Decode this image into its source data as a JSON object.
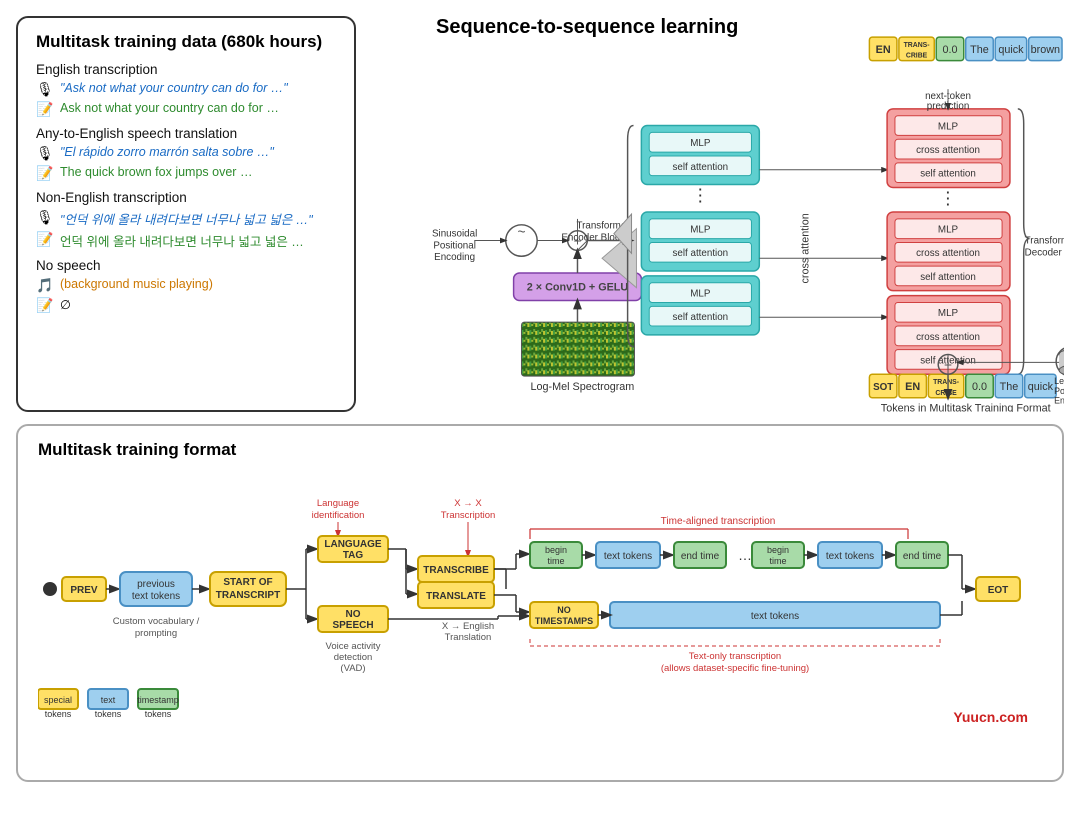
{
  "top": {
    "left_title": "Multitask training data (680k hours)",
    "sections": [
      {
        "label": "English transcription",
        "rows": [
          {
            "icon": "🎙",
            "text": "\"Ask not what your country can do for …\"",
            "type": "blue"
          },
          {
            "icon": "📝",
            "text": "Ask not what your country can do for …",
            "type": "green"
          }
        ]
      },
      {
        "label": "Any-to-English speech translation",
        "rows": [
          {
            "icon": "🎙",
            "text": "\"El rápido zorro marrón salta sobre …\"",
            "type": "blue"
          },
          {
            "icon": "📝",
            "text": "The quick brown fox jumps over …",
            "type": "green"
          }
        ]
      },
      {
        "label": "Non-English transcription",
        "rows": [
          {
            "icon": "🎙",
            "text": "\"언덕 위에 올라 내려다보면 너무나 넓고 넓은 …\"",
            "type": "blue"
          },
          {
            "icon": "📝",
            "text": "언덕 위에 올라 내려다보면 너무나 넓고 넓은 …",
            "type": "green"
          }
        ]
      },
      {
        "label": "No speech",
        "rows": [
          {
            "icon": "🎵",
            "text": "(background music playing)",
            "type": "orange"
          },
          {
            "icon": "📝",
            "text": "∅",
            "type": "plain"
          }
        ]
      }
    ],
    "seq_title": "Sequence-to-sequence learning"
  },
  "bottom": {
    "title": "Multitask training format",
    "nodes": {
      "prev": "PREV",
      "prev_text": "previous\ntext tokens",
      "sot": "START OF\nTRANSCRIPT",
      "lang_tag": "LANGUAGE\nTAG",
      "no_speech": "NO\nSPEECH",
      "transcribe": "TRANSCRIBE",
      "translate": "TRANSLATE",
      "begin_time": "begin\ntime",
      "text_tokens": "text tokens",
      "end_time": "end time",
      "no_timestamps": "NO\nTIMESTAMPS",
      "text_tokens2": "text tokens",
      "eot": "EOT"
    },
    "annotations": {
      "custom_vocab": "Custom vocabulary /\nprompting",
      "lang_id": "Language\nidentification",
      "xx_transcription": "X → X\nTranscription",
      "vad": "Voice activity\ndetection\n(VAD)",
      "xx_english": "X → English\nTranslation",
      "time_aligned": "Time-aligned transcription",
      "text_only": "Text-only transcription\n(allows dataset-specific fine-tuning)"
    },
    "legend": [
      {
        "color": "yellow",
        "label": "special\ntokens"
      },
      {
        "color": "blue",
        "label": "text\ntokens"
      },
      {
        "color": "green",
        "label": "timestamp\ntokens"
      }
    ],
    "watermark": "Yuucn.com"
  }
}
